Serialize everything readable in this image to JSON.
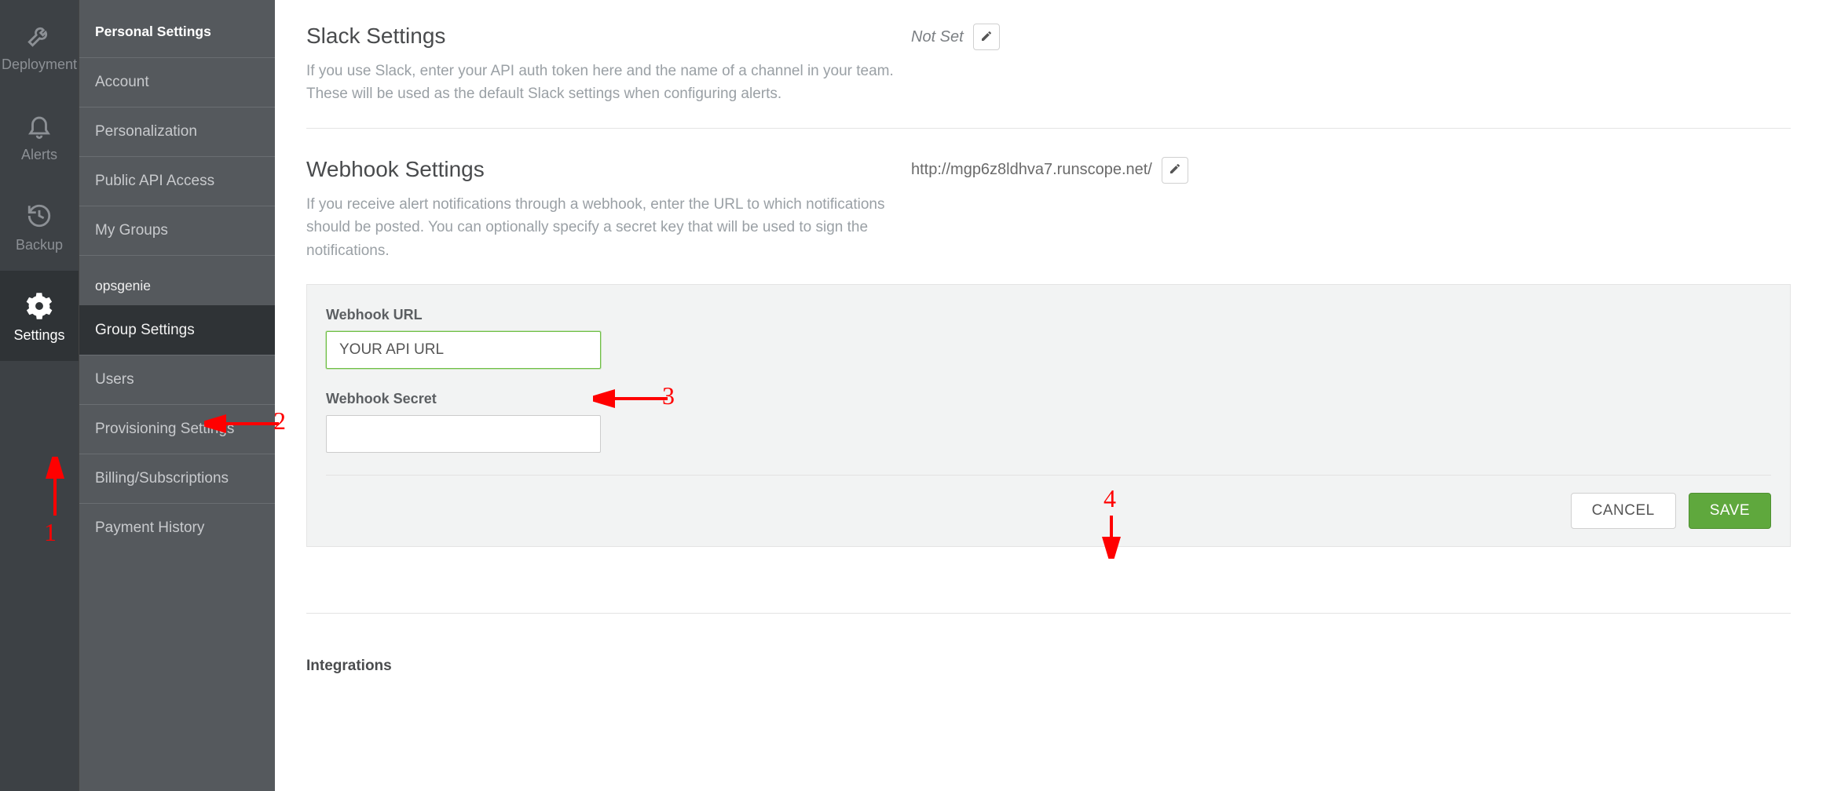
{
  "rail": {
    "items": [
      {
        "name": "deployment",
        "label": "Deployment"
      },
      {
        "name": "alerts",
        "label": "Alerts"
      },
      {
        "name": "backup",
        "label": "Backup"
      },
      {
        "name": "settings",
        "label": "Settings"
      }
    ]
  },
  "sidemenu": {
    "section_personal": "Personal Settings",
    "personal_items": [
      "Account",
      "Personalization",
      "Public API Access",
      "My Groups"
    ],
    "group_name": "opsgenie",
    "group_items": [
      "Group Settings",
      "Users",
      "Provisioning Settings",
      "Billing/Subscriptions",
      "Payment History"
    ]
  },
  "slack": {
    "heading": "Slack Settings",
    "desc": "If you use Slack, enter your API auth token here and the name of a channel in your team. These will be used as the default Slack settings when configuring alerts.",
    "status": "Not Set"
  },
  "webhook": {
    "heading": "Webhook Settings",
    "desc": "If you receive alert notifications through a webhook, enter the URL to which notifications should be posted. You can optionally specify a secret key that will be used to sign the notifications.",
    "current_url": "http://mgp6z8ldhva7.runscope.net/",
    "url_label": "Webhook URL",
    "url_value": "YOUR API URL",
    "secret_label": "Webhook Secret",
    "secret_value": "",
    "cancel": "CANCEL",
    "save": "SAVE"
  },
  "integrations": {
    "heading": "Integrations"
  },
  "annotations": {
    "a1": "1",
    "a2": "2",
    "a3": "3",
    "a4": "4"
  }
}
